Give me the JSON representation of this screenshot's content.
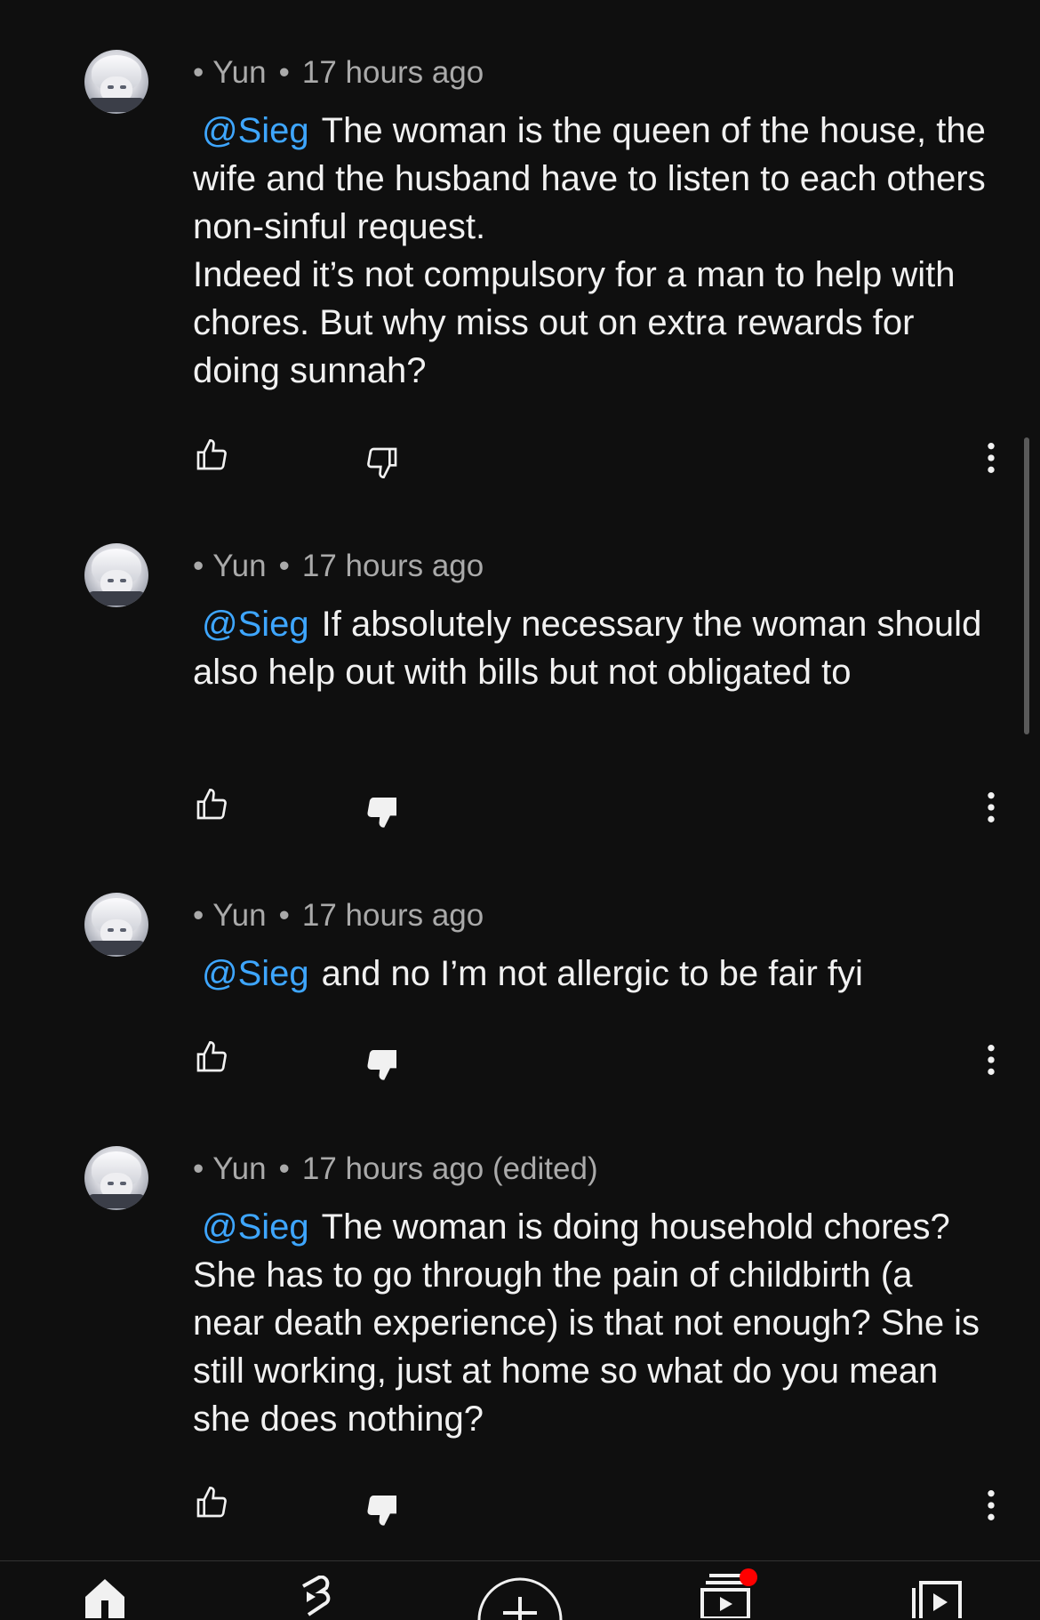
{
  "comments": [
    {
      "author": "Yun",
      "time": "17 hours ago",
      "mention": "@Sieg",
      "lines": [
        "The woman is the queen of the house, the wife and the husband have to listen to each others non-sinful request.",
        "Indeed it’s not compulsory for a man to help with chores. But why miss out on extra rewards for doing sunnah?"
      ],
      "disliked": false
    },
    {
      "author": "Yun",
      "time": "17 hours ago",
      "mention": "@Sieg",
      "lines": [
        "If absolutely necessary the woman should also help out with bills but not obligated to"
      ],
      "disliked": true
    },
    {
      "author": "Yun",
      "time": "17 hours ago",
      "mention": "@Sieg",
      "lines": [
        "and no I’m not allergic to be fair fyi"
      ],
      "disliked": true
    },
    {
      "author": "Yun",
      "time": "17 hours ago (edited)",
      "mention": "@Sieg",
      "lines": [
        "The woman is doing household chores? She has to go through the pain of childbirth (a near death experience) is that not enough? She is still working, just at home so what do you mean she does nothing?"
      ],
      "disliked": true
    }
  ],
  "bottom_nav": {
    "items": [
      "home-icon",
      "shorts-icon",
      "create-icon",
      "subscriptions-icon",
      "library-icon"
    ],
    "notification_color": "#ff0000"
  },
  "colors": {
    "background": "#0f0f0f",
    "mention": "#3ea6ff",
    "meta": "#aaaaaa",
    "text": "#f1f1f1"
  }
}
